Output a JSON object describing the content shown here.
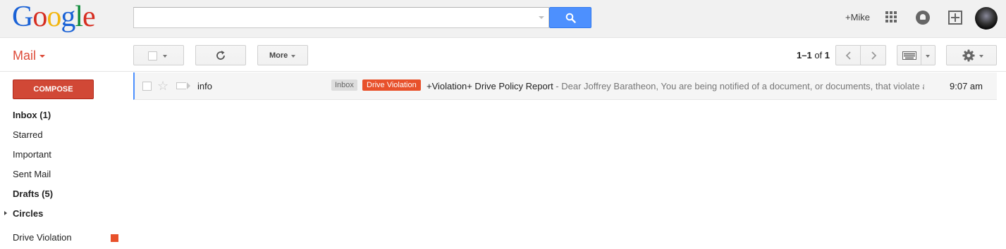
{
  "header": {
    "logo_text": "Google",
    "search_placeholder": "",
    "user_link": "+Mike"
  },
  "toolbar": {
    "mail_label": "Mail",
    "more_label": "More",
    "pager": {
      "range": "1–1",
      "of_label": "of",
      "total": "1"
    }
  },
  "sidebar": {
    "compose_label": "COMPOSE",
    "items": [
      {
        "label": "Inbox (1)",
        "bold": true
      },
      {
        "label": "Starred",
        "bold": false
      },
      {
        "label": "Important",
        "bold": false
      },
      {
        "label": "Sent Mail",
        "bold": false
      },
      {
        "label": "Drafts (5)",
        "bold": true
      },
      {
        "label": "Circles",
        "bold": true
      }
    ],
    "labels": [
      {
        "label": "Drive Violation",
        "color": "#e8512b"
      }
    ]
  },
  "emails": [
    {
      "sender": "info",
      "tags": [
        "Inbox",
        "Drive Violation"
      ],
      "subject": "+Violation+ Drive Policy Report",
      "snippet": " - Dear Joffrey Baratheon, You are being notified of a document, or documents, that violate a",
      "time": "9:07 am",
      "starred": false,
      "unread": false
    }
  ],
  "colors": {
    "accent_red": "#dd4b39",
    "compose_red": "#d14836",
    "search_blue": "#4d90fe",
    "drive_violation_tag": "#e8512b"
  }
}
